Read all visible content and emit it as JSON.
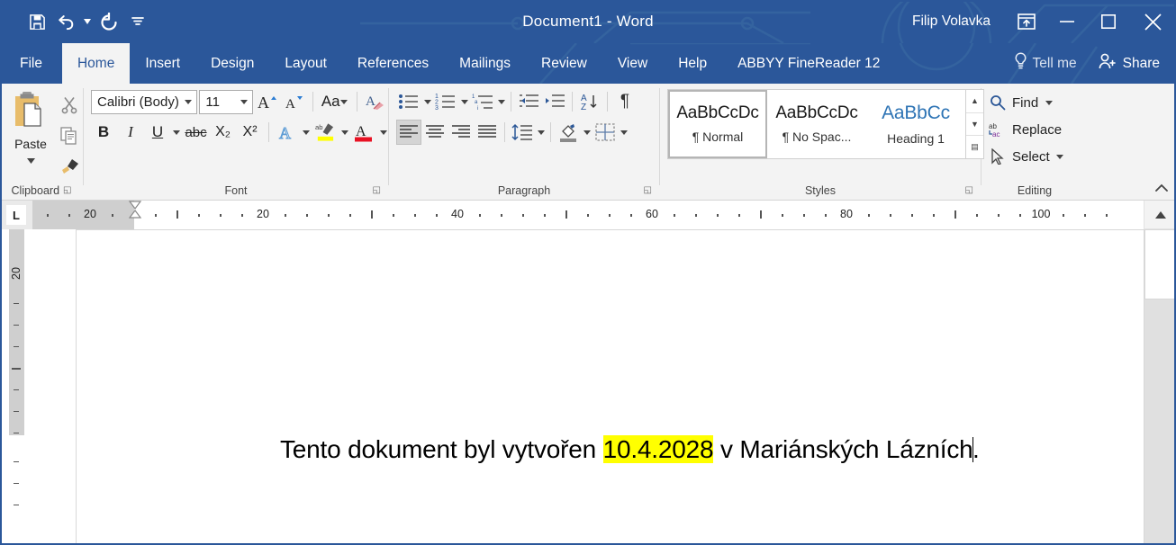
{
  "titlebar": {
    "quick_access": [
      {
        "name": "save",
        "label": "Save"
      },
      {
        "name": "undo",
        "label": "Undo"
      },
      {
        "name": "redo",
        "label": "Redo"
      },
      {
        "name": "customize",
        "label": "Customize Quick Access Toolbar"
      }
    ],
    "title": "Document1  -  Word",
    "user": "Filip Volavka",
    "window_controls": [
      {
        "name": "ribbon-display-options",
        "label": "Ribbon Display Options"
      },
      {
        "name": "minimize",
        "label": "Minimize"
      },
      {
        "name": "maximize",
        "label": "Maximize"
      },
      {
        "name": "close",
        "label": "Close"
      }
    ],
    "accent_color": "#2b579a"
  },
  "tabs": [
    {
      "id": "file",
      "label": "File",
      "active": false
    },
    {
      "id": "home",
      "label": "Home",
      "active": true
    },
    {
      "id": "insert",
      "label": "Insert",
      "active": false
    },
    {
      "id": "design",
      "label": "Design",
      "active": false
    },
    {
      "id": "layout",
      "label": "Layout",
      "active": false
    },
    {
      "id": "references",
      "label": "References",
      "active": false
    },
    {
      "id": "mailings",
      "label": "Mailings",
      "active": false
    },
    {
      "id": "review",
      "label": "Review",
      "active": false
    },
    {
      "id": "view",
      "label": "View",
      "active": false
    },
    {
      "id": "help",
      "label": "Help",
      "active": false
    },
    {
      "id": "abbyy",
      "label": "ABBYY FineReader 12",
      "active": false
    }
  ],
  "tellme": {
    "label": "Tell me",
    "icon": "lightbulb-icon"
  },
  "share": {
    "label": "Share",
    "icon": "person-add-icon"
  },
  "ribbon": {
    "clipboard": {
      "group_label": "Clipboard",
      "paste_label": "Paste",
      "cut_label": "Cut",
      "copy_label": "Copy",
      "format_painter_label": "Format Painter"
    },
    "font": {
      "group_label": "Font",
      "font_name": "Calibri (Body)",
      "font_size": "11",
      "grow_font": "Increase Font Size",
      "shrink_font": "Decrease Font Size",
      "change_case": "Aa",
      "clear_formatting": "Clear All Formatting",
      "bold": "B",
      "italic": "I",
      "underline": "U",
      "strikethrough": "abc",
      "subscript": "X₂",
      "superscript": "X²",
      "text_effects": "A",
      "highlight_color": "#ffff00",
      "font_color": "#e81123"
    },
    "paragraph": {
      "group_label": "Paragraph",
      "bullets": "Bullets",
      "numbering": "Numbering",
      "multilevel": "Multilevel List",
      "decrease_indent": "Decrease Indent",
      "increase_indent": "Increase Indent",
      "sort": "Sort",
      "show_marks": "¶",
      "align_left": "Align Left",
      "align_center": "Center",
      "align_right": "Align Right",
      "justify": "Justify",
      "line_spacing": "Line and Paragraph Spacing",
      "shading": "Shading",
      "borders": "Borders"
    },
    "styles": {
      "group_label": "Styles",
      "items": [
        {
          "sample": "AaBbCcDc",
          "name": "¶ Normal",
          "selected": true,
          "heading": false
        },
        {
          "sample": "AaBbCcDc",
          "name": "¶ No Spac...",
          "selected": false,
          "heading": false
        },
        {
          "sample": "AaBbCc",
          "name": "Heading 1",
          "selected": false,
          "heading": true
        }
      ]
    },
    "editing": {
      "group_label": "Editing",
      "find": "Find",
      "replace": "Replace",
      "select": "Select"
    },
    "collapse_label": "Collapse the Ribbon"
  },
  "ruler": {
    "tab_selector": "L",
    "horizontal_numbers": [
      "20",
      "20",
      "40",
      "60",
      "80",
      "100"
    ],
    "vertical_numbers": [
      "20"
    ]
  },
  "document": {
    "text_before": "Tento dokument byl vytvořen ",
    "highlighted": "10.4.2028",
    "text_after": " v Mariánských Lázních",
    "text_end": ".",
    "highlight_color": "#ffff00"
  }
}
